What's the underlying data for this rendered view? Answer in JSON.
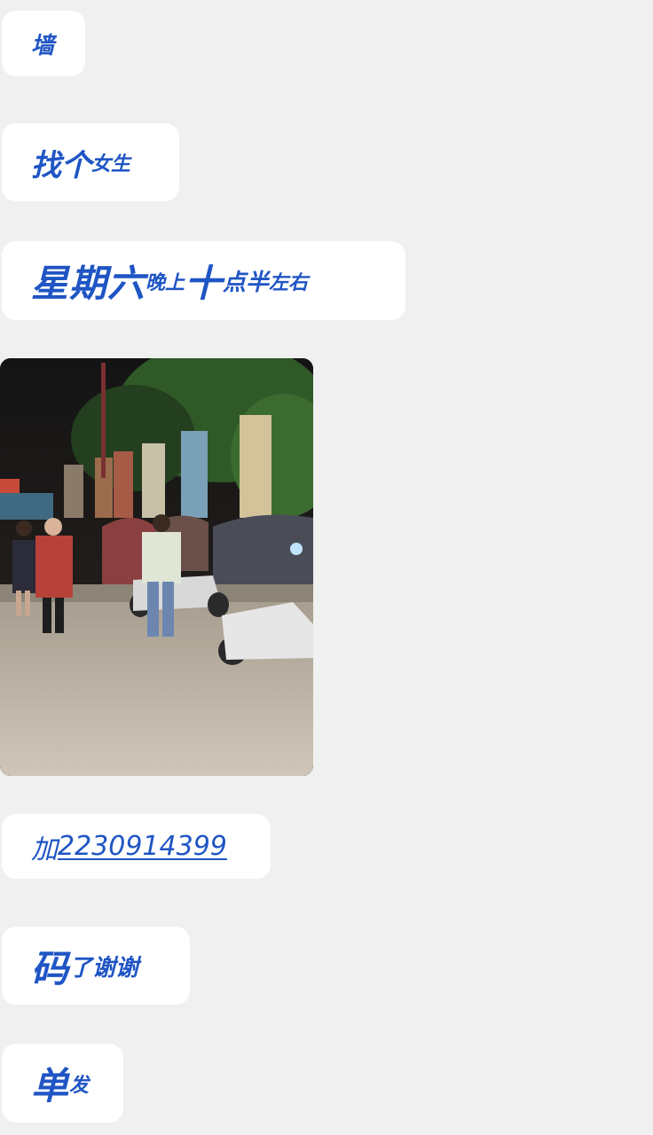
{
  "messages": {
    "m1": {
      "text": "墙"
    },
    "m2": {
      "big": "找个",
      "small": "女生"
    },
    "m3": {
      "part1": "星期六",
      "part2": "晚上",
      "part3": "十",
      "part4": "点半",
      "part5": "左右"
    },
    "m4": {
      "image": "street-night-photo"
    },
    "m5": {
      "prefix": "加",
      "phone": "2230914399"
    },
    "m6": {
      "big": "码",
      "small": "了谢谢"
    },
    "m7": {
      "big": "单",
      "small": "发"
    }
  },
  "colors": {
    "background": "#f0f0f0",
    "bubble": "#ffffff",
    "text": "#1f55c4"
  }
}
